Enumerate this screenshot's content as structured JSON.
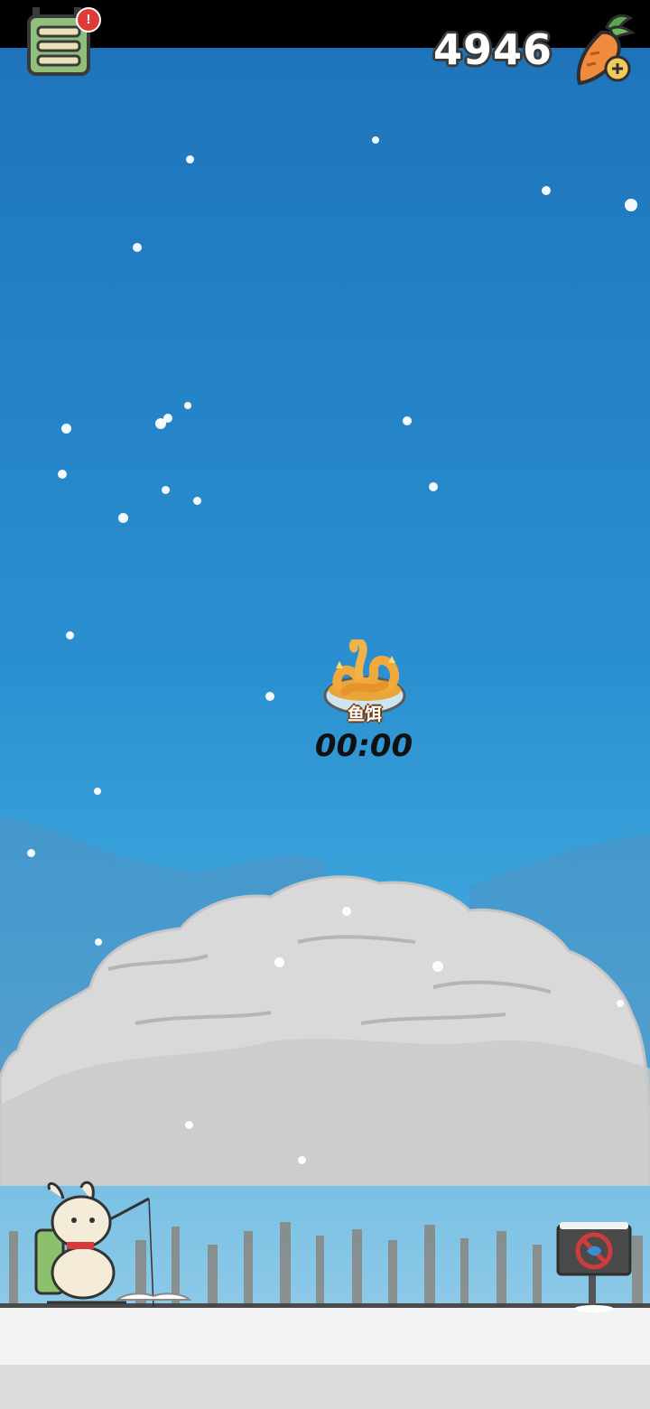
{
  "hud": {
    "carrot_count": "4946",
    "menu_badge": "!",
    "icons": {
      "menu": "menu-icon",
      "carrot_add": "carrot-plus-icon"
    }
  },
  "bait": {
    "label": "鱼饵",
    "timer": "00:00",
    "icon": "worm-bait-icon"
  },
  "scene": {
    "colors": {
      "sky_top": "#1e74bb",
      "sky_bottom": "#9fd0ea",
      "tree_snow": "#d8d8d8",
      "ground": "#f3f3f3"
    }
  }
}
